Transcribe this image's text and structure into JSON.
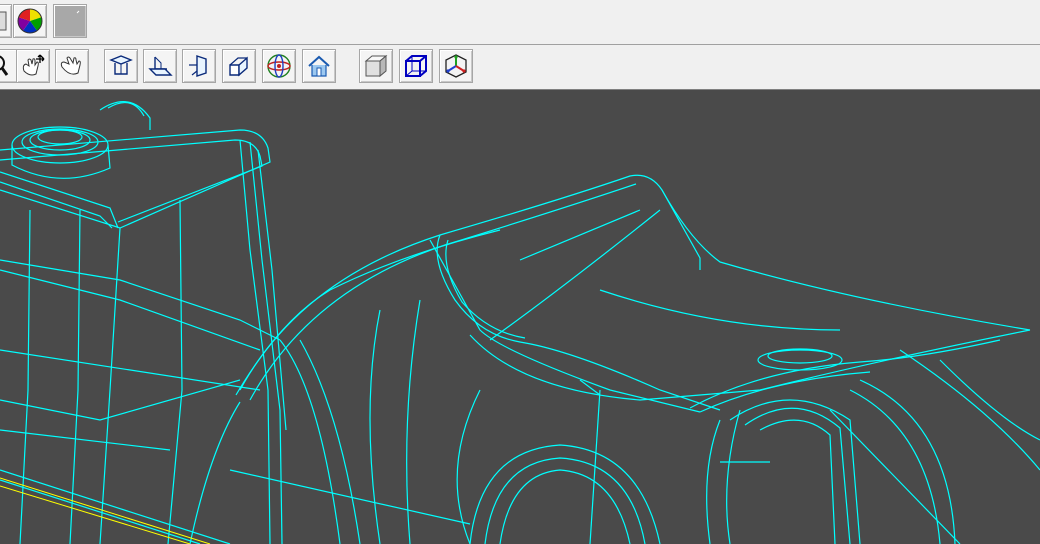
{
  "toolbar_top": {
    "buttons": [
      {
        "name": "window-button-partial",
        "icon": "window-icon"
      },
      {
        "name": "color-wheel-button",
        "icon": "color-wheel-icon"
      },
      {
        "name": "swatch-button",
        "icon": "gray-swatch-icon"
      }
    ]
  },
  "toolbar_view": {
    "buttons": [
      {
        "name": "zoom-button",
        "icon": "magnifier-icon"
      },
      {
        "name": "pan-button",
        "icon": "hand-move-icon"
      },
      {
        "name": "rotate-button",
        "icon": "hand-icon"
      },
      {
        "name": "view-top-button",
        "icon": "view-top-icon"
      },
      {
        "name": "view-front-button",
        "icon": "view-front-icon"
      },
      {
        "name": "view-side-button",
        "icon": "view-side-icon"
      },
      {
        "name": "view-iso-button",
        "icon": "view-iso-icon"
      },
      {
        "name": "view-sphere-button",
        "icon": "sphere-axes-icon"
      },
      {
        "name": "view-home-button",
        "icon": "home-icon"
      },
      {
        "name": "shaded-mode-button",
        "icon": "shaded-cube-icon"
      },
      {
        "name": "wireframe-mode-button",
        "icon": "wireframe-cube-icon"
      },
      {
        "name": "axes-mode-button",
        "icon": "axes-cube-icon"
      }
    ]
  },
  "viewport": {
    "background": "#4a4a4a",
    "wire_color": "#00ffff",
    "accent_color": "#ffff00"
  }
}
